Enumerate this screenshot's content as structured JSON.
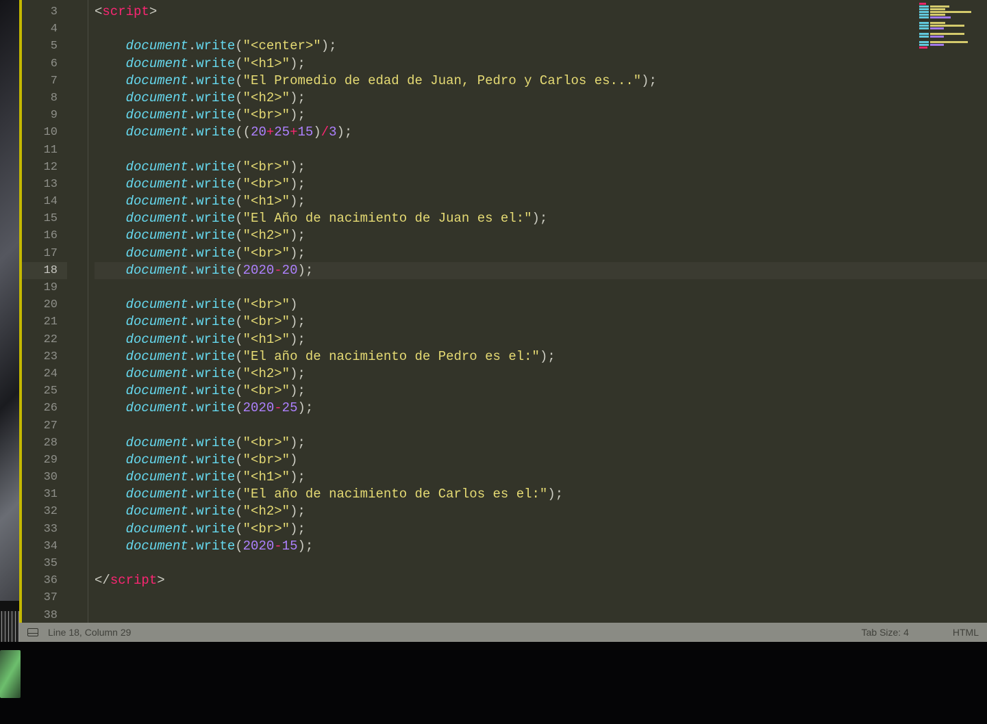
{
  "gutter": {
    "start": 3,
    "count": 36,
    "active": 18
  },
  "code": {
    "lines": [
      {
        "n": 3,
        "seg": [
          [
            "br",
            "<"
          ],
          [
            "tg",
            "script"
          ],
          [
            "br",
            ">"
          ]
        ]
      },
      {
        "n": 4,
        "seg": []
      },
      {
        "n": 5,
        "seg": [
          [
            "sp",
            "    "
          ],
          [
            "obj",
            "document"
          ],
          [
            "p",
            "."
          ],
          [
            "fn",
            "write"
          ],
          [
            "p",
            "("
          ],
          [
            "str",
            "\"<center>\""
          ],
          [
            "p",
            ");"
          ]
        ]
      },
      {
        "n": 6,
        "seg": [
          [
            "sp",
            "    "
          ],
          [
            "obj",
            "document"
          ],
          [
            "p",
            "."
          ],
          [
            "fn",
            "write"
          ],
          [
            "p",
            "("
          ],
          [
            "str",
            "\"<h1>\""
          ],
          [
            "p",
            ");"
          ]
        ]
      },
      {
        "n": 7,
        "seg": [
          [
            "sp",
            "    "
          ],
          [
            "obj",
            "document"
          ],
          [
            "p",
            "."
          ],
          [
            "fn",
            "write"
          ],
          [
            "p",
            "("
          ],
          [
            "str",
            "\"El Promedio de edad de Juan, Pedro y Carlos es...\""
          ],
          [
            "p",
            ");"
          ]
        ]
      },
      {
        "n": 8,
        "seg": [
          [
            "sp",
            "    "
          ],
          [
            "obj",
            "document"
          ],
          [
            "p",
            "."
          ],
          [
            "fn",
            "write"
          ],
          [
            "p",
            "("
          ],
          [
            "str",
            "\"<h2>\""
          ],
          [
            "p",
            ");"
          ]
        ]
      },
      {
        "n": 9,
        "seg": [
          [
            "sp",
            "    "
          ],
          [
            "obj",
            "document"
          ],
          [
            "p",
            "."
          ],
          [
            "fn",
            "write"
          ],
          [
            "p",
            "("
          ],
          [
            "str",
            "\"<br>\""
          ],
          [
            "p",
            ");"
          ]
        ]
      },
      {
        "n": 10,
        "seg": [
          [
            "sp",
            "    "
          ],
          [
            "obj",
            "document"
          ],
          [
            "p",
            "."
          ],
          [
            "fn",
            "write"
          ],
          [
            "p",
            "(("
          ],
          [
            "num",
            "20"
          ],
          [
            "op",
            "+"
          ],
          [
            "num",
            "25"
          ],
          [
            "op",
            "+"
          ],
          [
            "num",
            "15"
          ],
          [
            "p",
            ")"
          ],
          [
            "op",
            "/"
          ],
          [
            "num",
            "3"
          ],
          [
            "p",
            ");"
          ]
        ]
      },
      {
        "n": 11,
        "seg": []
      },
      {
        "n": 12,
        "seg": [
          [
            "sp",
            "    "
          ],
          [
            "obj",
            "document"
          ],
          [
            "p",
            "."
          ],
          [
            "fn",
            "write"
          ],
          [
            "p",
            "("
          ],
          [
            "str",
            "\"<br>\""
          ],
          [
            "p",
            ");"
          ]
        ]
      },
      {
        "n": 13,
        "seg": [
          [
            "sp",
            "    "
          ],
          [
            "obj",
            "document"
          ],
          [
            "p",
            "."
          ],
          [
            "fn",
            "write"
          ],
          [
            "p",
            "("
          ],
          [
            "str",
            "\"<br>\""
          ],
          [
            "p",
            ");"
          ]
        ]
      },
      {
        "n": 14,
        "seg": [
          [
            "sp",
            "    "
          ],
          [
            "obj",
            "document"
          ],
          [
            "p",
            "."
          ],
          [
            "fn",
            "write"
          ],
          [
            "p",
            "("
          ],
          [
            "str",
            "\"<h1>\""
          ],
          [
            "p",
            ");"
          ]
        ]
      },
      {
        "n": 15,
        "seg": [
          [
            "sp",
            "    "
          ],
          [
            "obj",
            "document"
          ],
          [
            "p",
            "."
          ],
          [
            "fn",
            "write"
          ],
          [
            "p",
            "("
          ],
          [
            "str",
            "\"El Año de nacimiento de Juan es el:\""
          ],
          [
            "p",
            ");"
          ]
        ]
      },
      {
        "n": 16,
        "seg": [
          [
            "sp",
            "    "
          ],
          [
            "obj",
            "document"
          ],
          [
            "p",
            "."
          ],
          [
            "fn",
            "write"
          ],
          [
            "p",
            "("
          ],
          [
            "str",
            "\"<h2>\""
          ],
          [
            "p",
            ");"
          ]
        ]
      },
      {
        "n": 17,
        "seg": [
          [
            "sp",
            "    "
          ],
          [
            "obj",
            "document"
          ],
          [
            "p",
            "."
          ],
          [
            "fn",
            "write"
          ],
          [
            "p",
            "("
          ],
          [
            "str",
            "\"<br>\""
          ],
          [
            "p",
            ");"
          ]
        ]
      },
      {
        "n": 18,
        "seg": [
          [
            "sp",
            "    "
          ],
          [
            "obj",
            "document"
          ],
          [
            "p",
            "."
          ],
          [
            "fn",
            "write"
          ],
          [
            "p",
            "("
          ],
          [
            "num",
            "2020"
          ],
          [
            "op",
            "-"
          ],
          [
            "num",
            "20"
          ],
          [
            "p",
            ");"
          ]
        ]
      },
      {
        "n": 19,
        "seg": []
      },
      {
        "n": 20,
        "seg": [
          [
            "sp",
            "    "
          ],
          [
            "obj",
            "document"
          ],
          [
            "p",
            "."
          ],
          [
            "fn",
            "write"
          ],
          [
            "p",
            "("
          ],
          [
            "str",
            "\"<br>\""
          ],
          [
            "p",
            ")"
          ]
        ]
      },
      {
        "n": 21,
        "seg": [
          [
            "sp",
            "    "
          ],
          [
            "obj",
            "document"
          ],
          [
            "p",
            "."
          ],
          [
            "fn",
            "write"
          ],
          [
            "p",
            "("
          ],
          [
            "str",
            "\"<br>\""
          ],
          [
            "p",
            ");"
          ]
        ]
      },
      {
        "n": 22,
        "seg": [
          [
            "sp",
            "    "
          ],
          [
            "obj",
            "document"
          ],
          [
            "p",
            "."
          ],
          [
            "fn",
            "write"
          ],
          [
            "p",
            "("
          ],
          [
            "str",
            "\"<h1>\""
          ],
          [
            "p",
            ");"
          ]
        ]
      },
      {
        "n": 23,
        "seg": [
          [
            "sp",
            "    "
          ],
          [
            "obj",
            "document"
          ],
          [
            "p",
            "."
          ],
          [
            "fn",
            "write"
          ],
          [
            "p",
            "("
          ],
          [
            "str",
            "\"El año de nacimiento de Pedro es el:\""
          ],
          [
            "p",
            ");"
          ]
        ]
      },
      {
        "n": 24,
        "seg": [
          [
            "sp",
            "    "
          ],
          [
            "obj",
            "document"
          ],
          [
            "p",
            "."
          ],
          [
            "fn",
            "write"
          ],
          [
            "p",
            "("
          ],
          [
            "str",
            "\"<h2>\""
          ],
          [
            "p",
            ");"
          ]
        ]
      },
      {
        "n": 25,
        "seg": [
          [
            "sp",
            "    "
          ],
          [
            "obj",
            "document"
          ],
          [
            "p",
            "."
          ],
          [
            "fn",
            "write"
          ],
          [
            "p",
            "("
          ],
          [
            "str",
            "\"<br>\""
          ],
          [
            "p",
            ");"
          ]
        ]
      },
      {
        "n": 26,
        "seg": [
          [
            "sp",
            "    "
          ],
          [
            "obj",
            "document"
          ],
          [
            "p",
            "."
          ],
          [
            "fn",
            "write"
          ],
          [
            "p",
            "("
          ],
          [
            "num",
            "2020"
          ],
          [
            "op",
            "-"
          ],
          [
            "num",
            "25"
          ],
          [
            "p",
            ");"
          ]
        ]
      },
      {
        "n": 27,
        "seg": []
      },
      {
        "n": 28,
        "seg": [
          [
            "sp",
            "    "
          ],
          [
            "obj",
            "document"
          ],
          [
            "p",
            "."
          ],
          [
            "fn",
            "write"
          ],
          [
            "p",
            "("
          ],
          [
            "str",
            "\"<br>\""
          ],
          [
            "p",
            ");"
          ]
        ]
      },
      {
        "n": 29,
        "seg": [
          [
            "sp",
            "    "
          ],
          [
            "obj",
            "document"
          ],
          [
            "p",
            "."
          ],
          [
            "fn",
            "write"
          ],
          [
            "p",
            "("
          ],
          [
            "str",
            "\"<br>\""
          ],
          [
            "p",
            ")"
          ]
        ]
      },
      {
        "n": 30,
        "seg": [
          [
            "sp",
            "    "
          ],
          [
            "obj",
            "document"
          ],
          [
            "p",
            "."
          ],
          [
            "fn",
            "write"
          ],
          [
            "p",
            "("
          ],
          [
            "str",
            "\"<h1>\""
          ],
          [
            "p",
            ");"
          ]
        ]
      },
      {
        "n": 31,
        "seg": [
          [
            "sp",
            "    "
          ],
          [
            "obj",
            "document"
          ],
          [
            "p",
            "."
          ],
          [
            "fn",
            "write"
          ],
          [
            "p",
            "("
          ],
          [
            "str",
            "\"El año de nacimiento de Carlos es el:\""
          ],
          [
            "p",
            ");"
          ]
        ]
      },
      {
        "n": 32,
        "seg": [
          [
            "sp",
            "    "
          ],
          [
            "obj",
            "document"
          ],
          [
            "p",
            "."
          ],
          [
            "fn",
            "write"
          ],
          [
            "p",
            "("
          ],
          [
            "str",
            "\"<h2>\""
          ],
          [
            "p",
            ");"
          ]
        ]
      },
      {
        "n": 33,
        "seg": [
          [
            "sp",
            "    "
          ],
          [
            "obj",
            "document"
          ],
          [
            "p",
            "."
          ],
          [
            "fn",
            "write"
          ],
          [
            "p",
            "("
          ],
          [
            "str",
            "\"<br>\""
          ],
          [
            "p",
            ");"
          ]
        ]
      },
      {
        "n": 34,
        "seg": [
          [
            "sp",
            "    "
          ],
          [
            "obj",
            "document"
          ],
          [
            "p",
            "."
          ],
          [
            "fn",
            "write"
          ],
          [
            "p",
            "("
          ],
          [
            "num",
            "2020"
          ],
          [
            "op",
            "-"
          ],
          [
            "num",
            "15"
          ],
          [
            "p",
            ");"
          ]
        ]
      },
      {
        "n": 35,
        "seg": []
      },
      {
        "n": 36,
        "seg": [
          [
            "br",
            "</"
          ],
          [
            "tg",
            "script"
          ],
          [
            "br",
            ">"
          ]
        ]
      },
      {
        "n": 37,
        "seg": []
      },
      {
        "n": 38,
        "seg": []
      }
    ]
  },
  "status": {
    "position": "Line 18, Column 29",
    "tabsize": "Tab Size: 4",
    "syntax": "HTML"
  }
}
